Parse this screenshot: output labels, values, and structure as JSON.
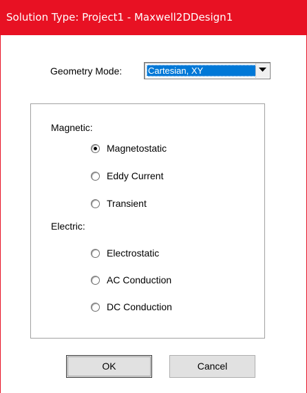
{
  "window": {
    "title": "Solution Type: Project1 - Maxwell2DDesign1"
  },
  "geometry": {
    "label": "Geometry Mode:",
    "selected": "Cartesian, XY"
  },
  "magnetic": {
    "label": "Magnetic:",
    "options": [
      {
        "label": "Magnetostatic",
        "selected": true
      },
      {
        "label": "Eddy Current",
        "selected": false
      },
      {
        "label": "Transient",
        "selected": false
      }
    ]
  },
  "electric": {
    "label": "Electric:",
    "options": [
      {
        "label": "Electrostatic",
        "selected": false
      },
      {
        "label": "AC Conduction",
        "selected": false
      },
      {
        "label": "DC Conduction",
        "selected": false
      }
    ]
  },
  "buttons": {
    "ok": "OK",
    "cancel": "Cancel"
  },
  "icons": {
    "dropdown": "chevron-down-icon"
  }
}
